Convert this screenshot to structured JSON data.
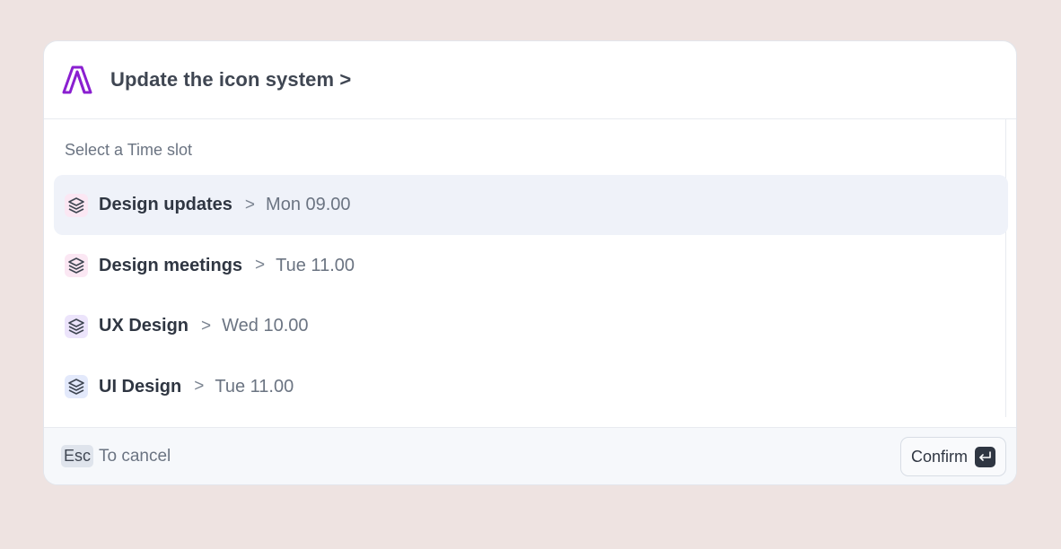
{
  "header": {
    "logo_icon": "brand-logo-icon",
    "title": "Update the icon system >"
  },
  "section": {
    "label": "Select a Time slot"
  },
  "items": [
    {
      "name": "Design updates",
      "separator": ">",
      "time": "Mon 09.00",
      "icon": "layers-icon",
      "icon_bg": "#fbe7f3",
      "active": true
    },
    {
      "name": "Design meetings",
      "separator": ">",
      "time": "Tue 11.00",
      "icon": "layers-icon",
      "icon_bg": "#fbe7f3",
      "active": false
    },
    {
      "name": "UX Design",
      "separator": ">",
      "time": "Wed 10.00",
      "icon": "layers-icon",
      "icon_bg": "#ece4fb",
      "active": false
    },
    {
      "name": "UI Design",
      "separator": ">",
      "time": "Tue 11.00",
      "icon": "layers-icon",
      "icon_bg": "#e3e9fb",
      "active": false
    }
  ],
  "footer": {
    "esc_key": "Esc",
    "cancel_text": "To cancel",
    "confirm_label": "Confirm",
    "enter_icon": "enter-key-icon"
  },
  "colors": {
    "brand": "#8a1fd0",
    "active_row": "#eff2f9"
  }
}
